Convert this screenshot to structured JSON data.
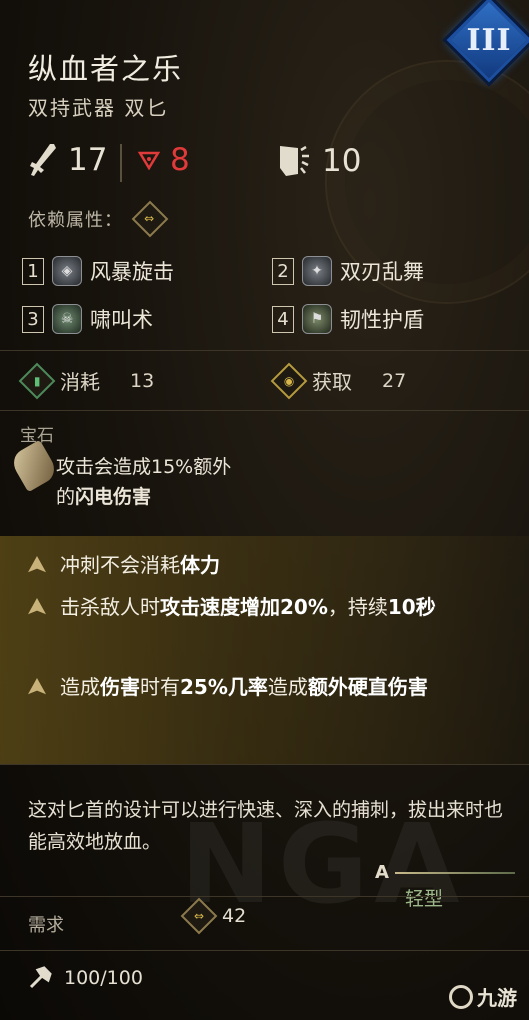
{
  "item": {
    "name": "纵血者之乐",
    "type": "双持武器 双匕",
    "tier": "III"
  },
  "stats": {
    "damage": "17",
    "weight_value": "8",
    "armor_break": "10"
  },
  "dependency": {
    "label": "依赖属性："
  },
  "skills": [
    {
      "num": "1",
      "label": "风暴旋击"
    },
    {
      "num": "2",
      "label": "双刃乱舞"
    },
    {
      "num": "3",
      "label": "啸叫术"
    },
    {
      "num": "4",
      "label": "韧性护盾"
    }
  ],
  "resources": {
    "consume_label": "消耗",
    "consume_value": "13",
    "gain_label": "获取",
    "gain_value": "27"
  },
  "gem": {
    "header": "宝石",
    "line1": "攻击会造成15%额外",
    "line2_plain": "的",
    "line2_bold": "闪电伤害"
  },
  "traits": [
    {
      "parts": [
        {
          "t": "冲刺不会消耗",
          "b": false
        },
        {
          "t": "体力",
          "b": true
        }
      ]
    },
    {
      "parts": [
        {
          "t": "击杀敌人时",
          "b": false
        },
        {
          "t": "攻击速度增加20%",
          "b": true
        },
        {
          "t": "，持续",
          "b": false
        },
        {
          "t": "10秒",
          "b": true
        }
      ]
    },
    {
      "parts": [
        {
          "t": "造成",
          "b": false
        },
        {
          "t": "伤害",
          "b": true
        },
        {
          "t": "时有",
          "b": false
        },
        {
          "t": "25%几率",
          "b": true
        },
        {
          "t": "造成",
          "b": false
        },
        {
          "t": "额外硬直伤害",
          "b": true
        }
      ]
    }
  ],
  "description": "这对匕首的设计可以进行快速、深入的捕刺，拔出来时也能高效地放血。",
  "class_tag": "轻型",
  "requirement": {
    "label": "需求",
    "value": "42"
  },
  "durability": {
    "value": "100/100"
  },
  "footer": {
    "watermark": "NGA",
    "brand": "九游"
  },
  "colors": {
    "accent_gold": "#c9b27a",
    "tier_blue": "#2f6fc4",
    "weight_red": "#e03a3a",
    "light_green": "#9db88a"
  }
}
